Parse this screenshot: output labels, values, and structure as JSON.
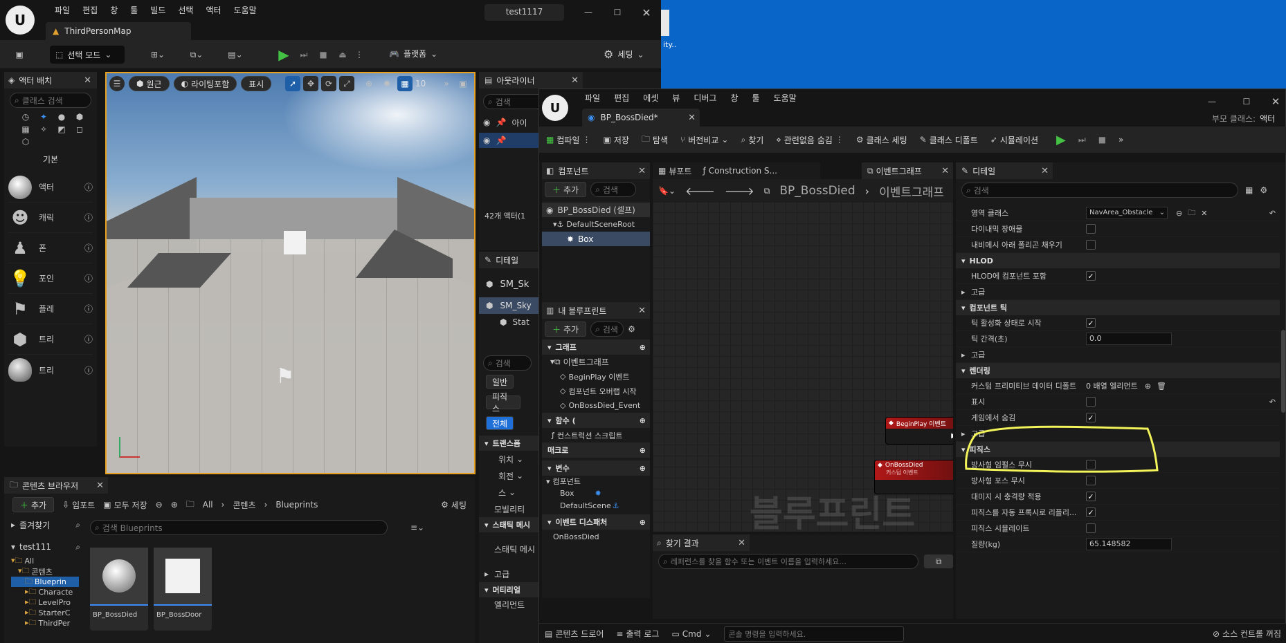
{
  "desktop": {
    "fragment": "ity.."
  },
  "editor": {
    "menu": [
      "파일",
      "편집",
      "창",
      "툴",
      "빌드",
      "선택",
      "액터",
      "도움말"
    ],
    "project": "test1117",
    "map_tab": "ThirdPersonMap",
    "toolbar": {
      "select_mode": "선택 모드",
      "platforms": "플랫폼",
      "settings": "세팅"
    },
    "place_actors": {
      "title": "액터 배치",
      "search_placeholder": "클래스 검색",
      "category": "기본",
      "items": [
        "액터",
        "캐릭",
        "폰",
        "포인",
        "플레",
        "트리",
        "트리"
      ]
    },
    "viewport": {
      "perspective": "원근",
      "lighting": "라이팅포함",
      "show": "표시",
      "grid_size": "10"
    },
    "outliner": {
      "title": "아웃라이너",
      "search": "검색",
      "col_label": "아이",
      "count": "42개 액터(1"
    },
    "details": {
      "title": "디테일",
      "items": [
        "SM_Sk",
        "SM_Sky",
        "Stat"
      ],
      "search": "검색",
      "tabs": [
        "일반",
        "피직스",
        "전체"
      ],
      "transform": "트랜스폼",
      "location": "위치",
      "rotation": "회전",
      "scale": "스",
      "mobility": "모빌리티",
      "static_mesh_section": "스태틱 메시",
      "static_mesh": "스태틱 메시",
      "advanced": "고급",
      "materials": "머티리얼",
      "element": "엘리먼트"
    },
    "content_browser": {
      "title": "콘텐츠 브라우저",
      "add": "추가",
      "import": "임포트",
      "save_all": "모두 저장",
      "path": [
        "All",
        "콘텐츠",
        "Blueprints"
      ],
      "settings": "세팅",
      "favorites": "즐겨찾기",
      "project": "test111",
      "search_placeholder": "검색 Blueprints",
      "tree": [
        "All",
        "콘텐츠",
        "Blueprin",
        "Characte",
        "LevelPro",
        "StarterC",
        "ThirdPer"
      ],
      "assets": [
        "BP_BossDied",
        "BP_BossDoor"
      ]
    }
  },
  "bp": {
    "menu": [
      "파일",
      "편집",
      "에셋",
      "뷰",
      "디버그",
      "창",
      "툴",
      "도움말"
    ],
    "tab": "BP_BossDied*",
    "parent_label": "부모 클래스:",
    "parent_value": "액터",
    "toolbar": {
      "compile": "컴파일",
      "save": "저장",
      "browse": "탐색",
      "diff": "버전비교",
      "find": "찾기",
      "hide_unrelated": "관련없음 숨김",
      "class_settings": "클래스 세팅",
      "class_defaults": "클래스 디폴트",
      "simulation": "시뮬레이션"
    },
    "components": {
      "title": "컴포넌트",
      "add": "추가",
      "search": "검색",
      "tree": [
        "BP_BossDied (셀프)",
        "DefaultSceneRoot",
        "Box"
      ]
    },
    "my_blueprint": {
      "title": "내 블루프린트",
      "add": "추가",
      "search": "검색",
      "graphs": "그래프",
      "event_graph": "이벤트그래프",
      "events": [
        "BeginPlay 이벤트",
        "컴포넌트 오버랩 시작",
        "OnBossDied_Event"
      ],
      "functions": "함수 (",
      "construction_script": "컨스트럭션 스크립트",
      "macros": "매크로",
      "variables": "변수",
      "components_cat": "컴포넌트",
      "vars": [
        "Box",
        "DefaultScene"
      ],
      "dispatchers": "이벤트 디스패처",
      "dispatcher_items": [
        "OnBossDied"
      ]
    },
    "graph_tabs": [
      "뷰포트",
      "Construction S...",
      "이벤트그래프"
    ],
    "breadcrumb": [
      "BP_BossDied",
      "이벤트그래프"
    ],
    "watermark": "블루프린트",
    "nodes": [
      {
        "title": "BeginPlay 이벤트"
      },
      {
        "title": "OnBossDied",
        "sub": "커스텀 이벤트"
      }
    ],
    "find_results": {
      "title": "찾기 결과",
      "placeholder": "레퍼런스를 찾을 함수 또는 이벤트 이름을 입력하세요..."
    },
    "details": {
      "title": "디테일",
      "search": "검색",
      "rows": [
        {
          "type": "prop",
          "name": "영역 클래스",
          "value": "NavArea_Obstacle",
          "kind": "dropdown"
        },
        {
          "type": "prop",
          "name": "다이내믹 장애물",
          "kind": "check",
          "checked": false
        },
        {
          "type": "prop",
          "name": "내비메시 아래 폴리곤 채우기",
          "kind": "check",
          "checked": false
        },
        {
          "type": "sec",
          "name": "HLOD"
        },
        {
          "type": "prop",
          "name": "HLOD에 컴포넌트 포함",
          "kind": "check",
          "checked": true
        },
        {
          "type": "sub",
          "name": "고급"
        },
        {
          "type": "sec",
          "name": "컴포넌트 틱"
        },
        {
          "type": "prop",
          "name": "틱 활성화 상태로 시작",
          "kind": "check",
          "checked": true
        },
        {
          "type": "prop",
          "name": "틱 간격(초)",
          "value": "0.0",
          "kind": "text"
        },
        {
          "type": "sub",
          "name": "고급"
        },
        {
          "type": "sec",
          "name": "렌더링"
        },
        {
          "type": "prop",
          "name": "커스텀 프리미티브 데이터 디폴트",
          "value": "0 배열 엘리먼트",
          "kind": "array"
        },
        {
          "type": "prop",
          "name": "표시",
          "kind": "check",
          "checked": false
        },
        {
          "type": "prop",
          "name": "게임에서 숨김",
          "kind": "check",
          "checked": true
        },
        {
          "type": "sub",
          "name": "고급"
        },
        {
          "type": "sec",
          "name": "피직스"
        },
        {
          "type": "prop",
          "name": "방사형 임펄스 무시",
          "kind": "check",
          "checked": false
        },
        {
          "type": "prop",
          "name": "방사형 포스 무시",
          "kind": "check",
          "checked": false
        },
        {
          "type": "prop",
          "name": "대미지 시 충격량 적용",
          "kind": "check",
          "checked": true
        },
        {
          "type": "prop",
          "name": "피직스를 자동 프록시로 리플리...",
          "kind": "check",
          "checked": true
        },
        {
          "type": "prop",
          "name": "피직스 시뮬레이트",
          "kind": "check",
          "checked": false
        },
        {
          "type": "prop",
          "name": "질량(kg)",
          "value": "65.148582",
          "kind": "text"
        }
      ]
    },
    "status": {
      "content_drawer": "콘텐츠 드로어",
      "output_log": "출력 로그",
      "cmd": "Cmd",
      "cmd_placeholder": "콘솔 명령을 입력하세요.",
      "source_control": "소스 컨트롤 꺼짐"
    }
  },
  "highlight_color": "#f3f35a"
}
